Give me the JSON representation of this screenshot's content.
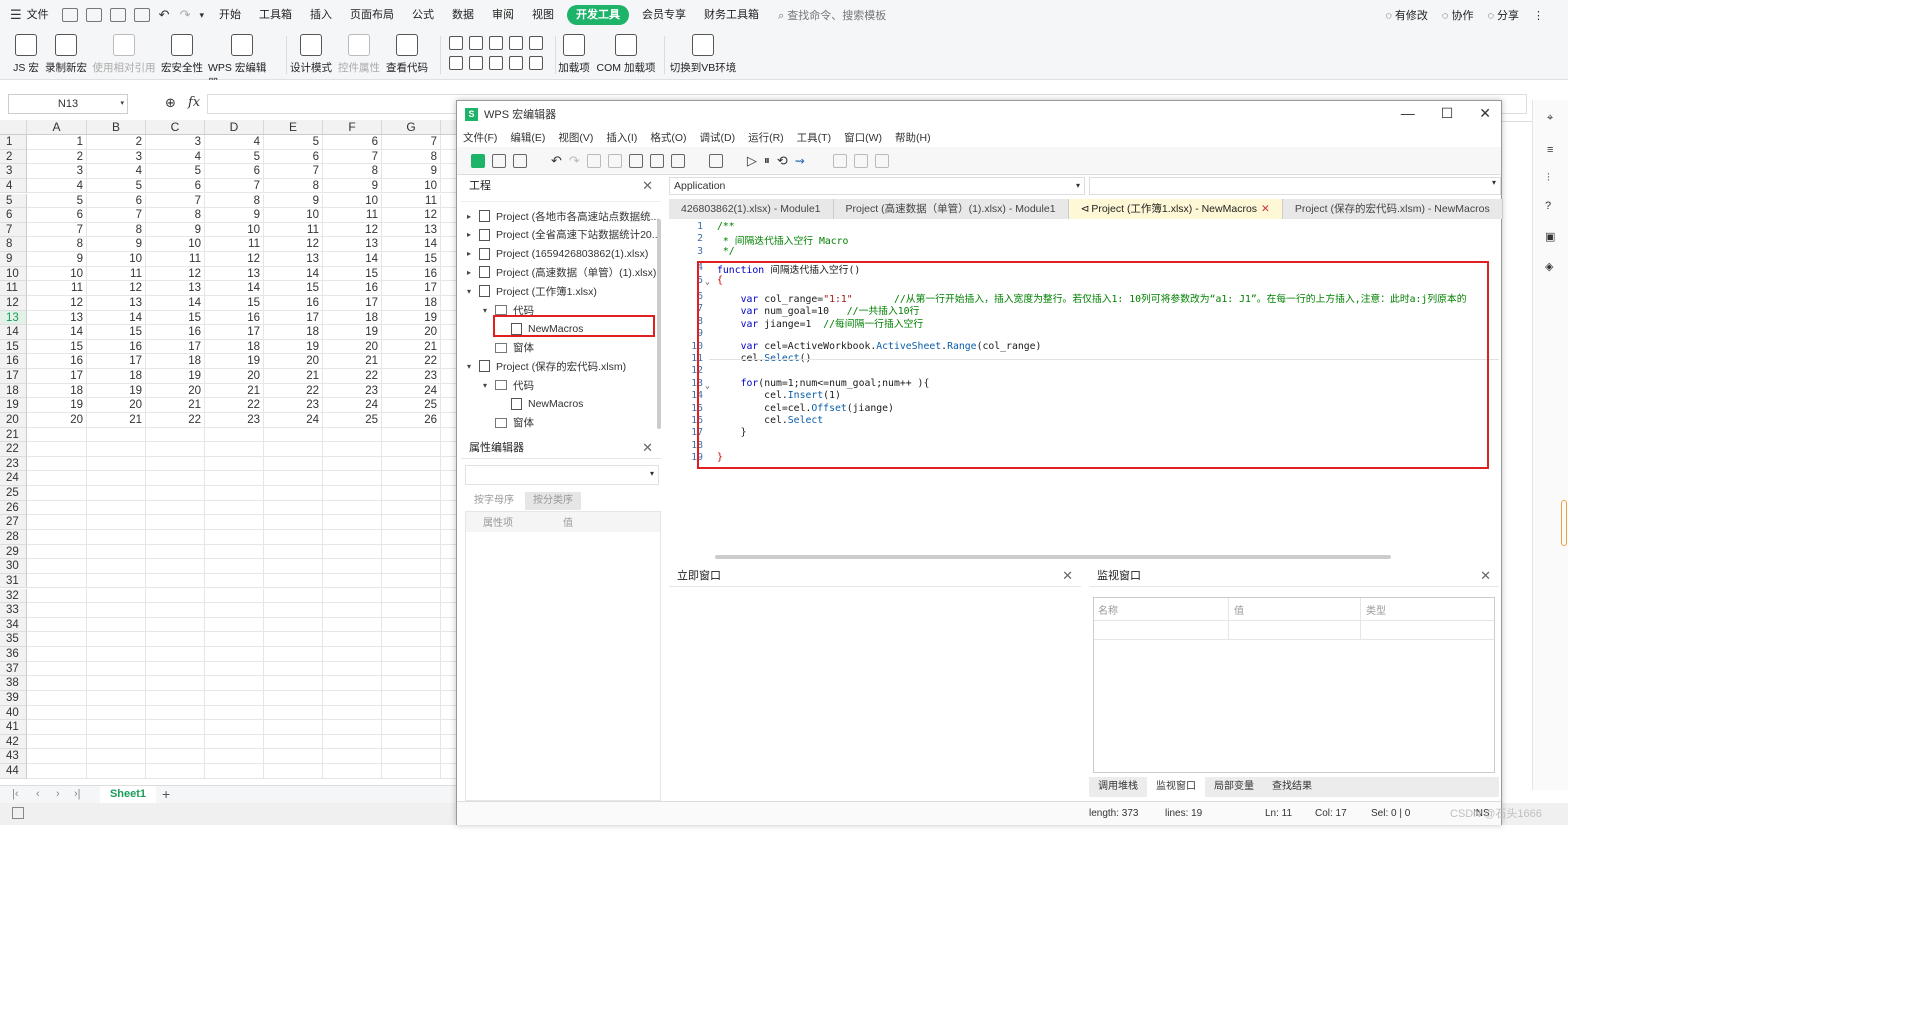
{
  "menubar": {
    "file": "文件",
    "items": [
      "开始",
      "工具箱",
      "插入",
      "页面布局",
      "公式",
      "数据",
      "审阅",
      "视图",
      "开发工具",
      "会员专享",
      "财务工具箱"
    ],
    "active": "开发工具",
    "search": "查找命令、搜索模板",
    "right": [
      "有修改",
      "协作",
      "分享"
    ]
  },
  "ribbon": {
    "buttons": [
      {
        "label": "JS 宏"
      },
      {
        "label": "录制新宏"
      },
      {
        "label": "使用相对引用",
        "disabled": true
      },
      {
        "label": "宏安全性"
      },
      {
        "label": "WPS 宏编辑器"
      },
      {
        "label": "设计模式"
      },
      {
        "label": "控件属性",
        "disabled": true
      },
      {
        "label": "查看代码"
      },
      {
        "label": "加载项"
      },
      {
        "label": "COM 加载项"
      },
      {
        "label": "切换到VB环境"
      }
    ]
  },
  "formula": {
    "namebox": "N13",
    "fx": "fx"
  },
  "sheet": {
    "columns": [
      "A",
      "B",
      "C",
      "D",
      "E",
      "F",
      "G"
    ],
    "rows": 44,
    "datarows": 20,
    "tab": "Sheet1"
  },
  "editor": {
    "title": "WPS 宏编辑器",
    "menu": [
      "文件(F)",
      "编辑(E)",
      "视图(V)",
      "插入(I)",
      "格式(O)",
      "调试(D)",
      "运行(R)",
      "工具(T)",
      "窗口(W)",
      "帮助(H)"
    ],
    "project_panel": "工程",
    "tree": [
      {
        "label": "Project (各地市各高速站点数据统..."
      },
      {
        "label": "Project (全省高速下站数据统计20..."
      },
      {
        "label": "Project (1659426803862(1).xlsx)"
      },
      {
        "label": "Project (高速数据（单管）(1).xlsx)"
      },
      {
        "label": "Project (工作簿1.xlsx)"
      },
      {
        "label": "代码"
      },
      {
        "label": "NewMacros"
      },
      {
        "label": "窗体"
      },
      {
        "label": "Project (保存的宏代码.xlsm)"
      },
      {
        "label": "代码"
      },
      {
        "label": "NewMacros"
      },
      {
        "label": "窗体"
      }
    ],
    "props_panel": "属性编辑器",
    "props_tabs": [
      "按字母序",
      "按分类序"
    ],
    "props_cols": [
      "属性项",
      "值"
    ],
    "object_select": "Application",
    "tabs": [
      "426803862(1).xlsx) - Module1",
      "Project (高速数据（单管）(1).xlsx) - Module1",
      "Project (工作簿1.xlsx) - NewMacros",
      "Project (保存的宏代码.xlsm) - NewMacros"
    ],
    "code": [
      {
        "n": "1",
        "t": "/**"
      },
      {
        "n": "2",
        "t": " * 间隔迭代插入空行 Macro"
      },
      {
        "n": "3",
        "t": " */"
      },
      {
        "n": "4",
        "t": "function 间隔迭代插入空行()"
      },
      {
        "n": "5",
        "t": "{"
      },
      {
        "n": "6",
        "t": "    var col_range=\"1:1\"       //从第一行开始插入，插入宽度为整行。若仅插入1: 10列可将参数改为“a1: J1”。在每一行的上方插入,注意：此时a:j列原本的"
      },
      {
        "n": "7",
        "t": "    var num_goal=10   //一共插入10行"
      },
      {
        "n": "8",
        "t": "    var jiange=1  //每间隔一行插入空行"
      },
      {
        "n": "9",
        "t": ""
      },
      {
        "n": "10",
        "t": "    var cel=ActiveWorkbook.ActiveSheet.Range(col_range)"
      },
      {
        "n": "11",
        "t": "    cel.Select()"
      },
      {
        "n": "12",
        "t": ""
      },
      {
        "n": "13",
        "t": "    for(num=1;num<=num_goal;num++ ){"
      },
      {
        "n": "14",
        "t": "        cel.Insert(1)"
      },
      {
        "n": "15",
        "t": "        cel=cel.Offset(jiange)"
      },
      {
        "n": "16",
        "t": "        cel.Select"
      },
      {
        "n": "17",
        "t": "    }"
      },
      {
        "n": "18",
        "t": ""
      },
      {
        "n": "19",
        "t": "}"
      }
    ],
    "immediate": "立即窗口",
    "watch": "监视窗口",
    "watch_cols": [
      "名称",
      "值",
      "类型"
    ],
    "bottom_tabs": [
      "调用堆栈",
      "监视窗口",
      "局部变量",
      "查找结果"
    ],
    "status": {
      "length": "length: 373",
      "lines": "lines: 19",
      "ln": "Ln: 11",
      "col": "Col: 17",
      "sel": "Sel: 0 | 0",
      "ins": "INS"
    }
  },
  "watermark": "CSDN @石头1666"
}
